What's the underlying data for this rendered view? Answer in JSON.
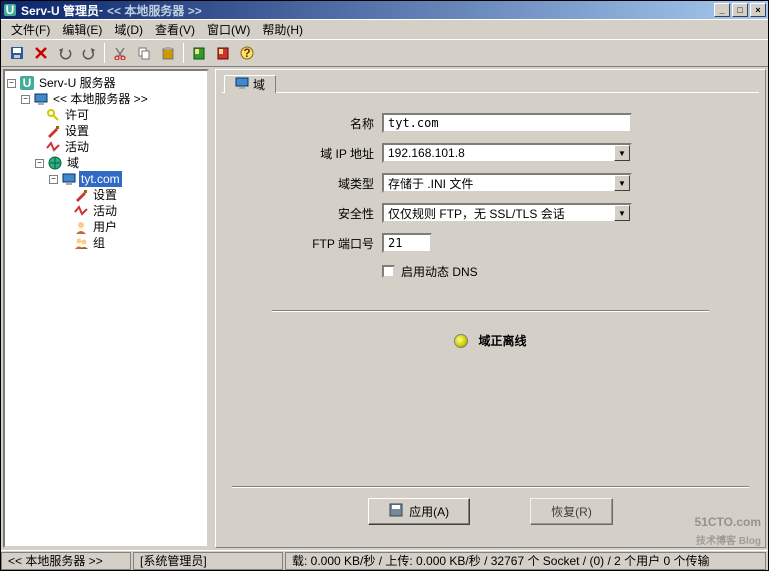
{
  "title": {
    "app": "Serv-U 管理员",
    "sep": " - ",
    "sub": "<< 本地服务器 >>"
  },
  "winbtns": {
    "min": "_",
    "max": "□",
    "close": "×"
  },
  "menu": [
    "文件(F)",
    "编辑(E)",
    "域(D)",
    "查看(V)",
    "窗口(W)",
    "帮助(H)"
  ],
  "tree": {
    "root": "Serv-U 服务器",
    "localsrv": "<< 本地服务器 >>",
    "perm": "许可",
    "settings": "设置",
    "activity": "活动",
    "domains": "域",
    "domain_tyt": "tyt.com",
    "d_settings": "设置",
    "d_activity": "活动",
    "d_users": "用户",
    "d_groups": "组"
  },
  "tab": {
    "label": "域"
  },
  "form": {
    "name_label": "名称",
    "name_value": "tyt.com",
    "ip_label": "域 IP 地址",
    "ip_value": "192.168.101.8",
    "type_label": "域类型",
    "type_value": "存储于 .INI 文件",
    "sec_label": "安全性",
    "sec_value": "仅仅规则 FTP，无 SSL/TLS 会话",
    "port_label": "FTP 端口号",
    "port_value": "21",
    "ddns_label": "启用动态 DNS",
    "status": "域正离线",
    "apply": "应用(A)",
    "restore": "恢复(R)"
  },
  "statusbar": {
    "a": "<< 本地服务器 >>",
    "b": "[系统管理员]",
    "c": "载: 0.000 KB/秒 / 上传: 0.000 KB/秒 / 32767 个 Socket / (0) / 2 个用户 0 个传输"
  },
  "watermark": {
    "big": "51CTO.com",
    "small": "技术博客  Blog"
  }
}
